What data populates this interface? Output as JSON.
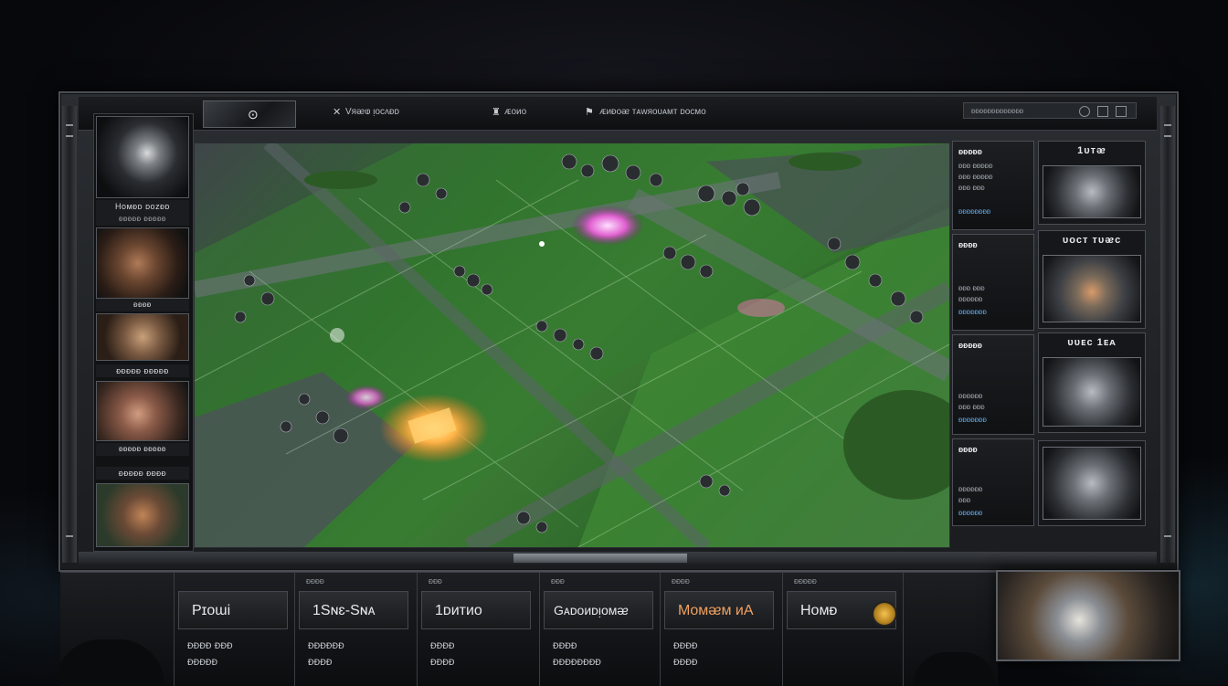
{
  "topbar": {
    "left_text": "Vᴙᴂⱷ ᴉᴏᴄᴧᴆᴅ",
    "mid_text": "ᴁᴏᴎᴏ",
    "right_text": "ᴁᴎᴆᴏᴂ ᴛᴀᴡᴙᴏᴜᴀᴍᴛ ᴅᴏᴄᴍᴏ",
    "status_text": "ᴆᴆᴆᴆᴆᴆᴆᴆᴆᴆᴆᴆᴆ"
  },
  "left_heroes": [
    {
      "caption": "Hᴏᴍᴆᴅ ᴅᴏᴢᴆᴅ",
      "sub": "ᴆᴆᴆᴆᴆ ᴆᴆᴆᴆᴆ"
    },
    {
      "caption": "ᴆᴆᴆᴆ"
    },
    {
      "caption": "ᴆᴆᴆᴆᴆ ᴆᴆᴆᴆᴆ"
    },
    {
      "caption": "ᴆᴆᴆᴆᴆ ᴆᴆᴆᴆᴆ"
    },
    {
      "caption": "ᴆᴆᴆᴆᴆ ᴆᴆᴆᴆ"
    }
  ],
  "info_panels": [
    {
      "title": "ᴆᴆᴆᴆᴆ",
      "lines": [
        "ᴆᴆᴆ ᴆᴆᴆᴆᴆ",
        "ᴆᴆᴆ ᴆᴆᴆᴆᴆ",
        "ᴆᴆᴆ ᴆᴆᴆ"
      ],
      "blue": "ᴆᴆᴆᴆᴆᴆᴆᴆ"
    },
    {
      "title": "ᴆᴆᴆᴆ",
      "lines": [
        "ᴆᴆᴆ ᴆᴆᴆ",
        "ᴆᴆᴆᴆᴆᴆ"
      ],
      "blue": "ᴆᴆᴆᴆᴆᴆᴆ"
    },
    {
      "title": "ᴆᴆᴆᴆᴆ",
      "lines": [
        "ᴆᴆᴆᴆᴆᴆ",
        "ᴆᴆᴆ ᴆᴆᴆ"
      ],
      "blue": "ᴆᴆᴆᴆᴆᴆᴆ"
    },
    {
      "title": "ᴆᴆᴆᴆ",
      "lines": [
        "ᴆᴆᴆᴆᴆᴆ",
        "ᴆᴆᴆ"
      ],
      "blue": "ᴆᴆᴆᴆᴆᴆ"
    }
  ],
  "unit_cards": [
    {
      "label": "1ᴜᴛᴂ"
    },
    {
      "label": "ᴜᴏᴄᴛ ᴛᴜᴂᴄ"
    },
    {
      "label": "ᴜᴜᴇᴄ 1ᴇᴀ"
    },
    {
      "label": ""
    }
  ],
  "commands": [
    {
      "head": "",
      "label": "Pɪoɯi",
      "sub1": "ᴆᴆᴆᴆ ᴆᴆᴆ",
      "sub2": "ᴆᴆᴆᴆᴆ"
    },
    {
      "head": "ᴆᴆᴆᴆ",
      "label": "1Sɴɛ-Sɴᴀ",
      "sub1": "ᴆᴆᴆᴆᴆᴆ",
      "sub2": "ᴆᴆᴆᴆ"
    },
    {
      "head": "ᴆᴆᴆ",
      "label": "1ᴅᴎᴛᴎᴏ",
      "sub1": "ᴆᴆᴆᴆ",
      "sub2": "ᴆᴆᴆᴆ"
    },
    {
      "head": "ᴆᴆᴆ",
      "label": "Gᴀᴅᴏᴎᴅᴉᴏᴍᴂ",
      "sub1": "ᴆᴆᴆᴆ",
      "sub2": "ᴆᴆᴆᴆᴆᴆᴆᴆ"
    },
    {
      "head": "ᴆᴆᴆᴆ",
      "label": "Mᴏᴍᴂᴍ ᴎA",
      "sub1": "ᴆᴆᴆᴆ",
      "sub2": "ᴆᴆᴆᴆ"
    },
    {
      "head": "ᴆᴆᴆᴆᴆ",
      "label": "Hᴏᴍᴆ",
      "sub1": "",
      "sub2": ""
    }
  ],
  "icons": {
    "command_coin": "coin-icon",
    "portrait": "hero-portrait"
  },
  "colors": {
    "accent_orange": "#f0a060",
    "info_blue": "#5fa0d8",
    "field_green": "#3d7d35",
    "glow_yellow": "#ffb347"
  }
}
